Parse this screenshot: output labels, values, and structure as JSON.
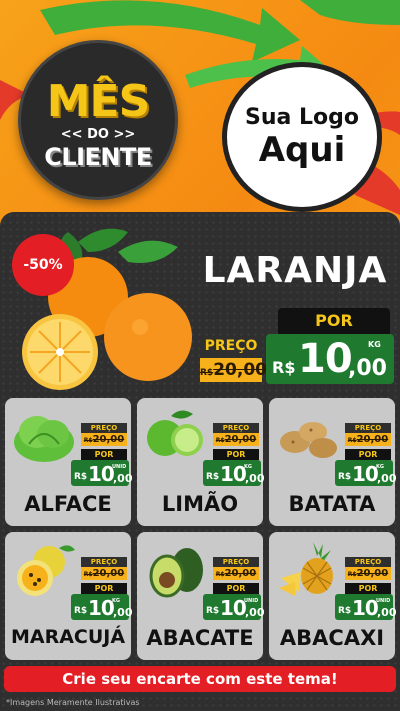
{
  "header": {
    "campaign_logo": {
      "line1": "MÊS",
      "line2": "<< DO >>",
      "line3": "CLIENTE"
    },
    "store_logo": {
      "line1": "Sua Logo",
      "line2": "Aqui"
    }
  },
  "featured": {
    "discount_badge": "-50%",
    "name": "LARANJA",
    "old_price_label": "PREÇO",
    "old_price_currency": "R$",
    "old_price_value": "20,00",
    "new_price_label": "POR",
    "currency": "R$",
    "price_int": "10",
    "price_dec": ",00",
    "unit": "KG"
  },
  "products": [
    {
      "name": "ALFACE",
      "old_label": "PREÇO",
      "old_currency": "R$",
      "old_value": "20,00",
      "new_label": "POR",
      "currency": "R$",
      "price_int": "10",
      "price_dec": ",00",
      "unit": "UNID",
      "icon": "lettuce-icon"
    },
    {
      "name": "LIMÃO",
      "old_label": "PREÇO",
      "old_currency": "R$",
      "old_value": "20,00",
      "new_label": "POR",
      "currency": "R$",
      "price_int": "10",
      "price_dec": ",00",
      "unit": "KG",
      "icon": "lime-icon"
    },
    {
      "name": "BATATA",
      "old_label": "PREÇO",
      "old_currency": "R$",
      "old_value": "20,00",
      "new_label": "POR",
      "currency": "R$",
      "price_int": "10",
      "price_dec": ",00",
      "unit": "KG",
      "icon": "potato-icon"
    },
    {
      "name": "MARACUJÁ",
      "old_label": "PREÇO",
      "old_currency": "R$",
      "old_value": "20,00",
      "new_label": "POR",
      "currency": "R$",
      "price_int": "10",
      "price_dec": ",00",
      "unit": "KG",
      "icon": "passion-fruit-icon"
    },
    {
      "name": "ABACATE",
      "old_label": "PREÇO",
      "old_currency": "R$",
      "old_value": "20,00",
      "new_label": "POR",
      "currency": "R$",
      "price_int": "10",
      "price_dec": ",00",
      "unit": "UNID",
      "icon": "avocado-icon"
    },
    {
      "name": "ABACAXI",
      "old_label": "PREÇO",
      "old_currency": "R$",
      "old_value": "20,00",
      "new_label": "POR",
      "currency": "R$",
      "price_int": "10",
      "price_dec": ",00",
      "unit": "UNID",
      "icon": "pineapple-icon"
    }
  ],
  "cta": {
    "label": "Crie seu encarte com este tema!"
  },
  "disclaimer": "*Imagens Meramente Ilustrativas",
  "colors": {
    "background": "#f7a21a",
    "panel": "#2f2f2f",
    "card": "#c9c9c9",
    "price_green": "#1f7a2f",
    "old_price_yellow": "#f7b21b",
    "accent_red": "#e31e24"
  }
}
